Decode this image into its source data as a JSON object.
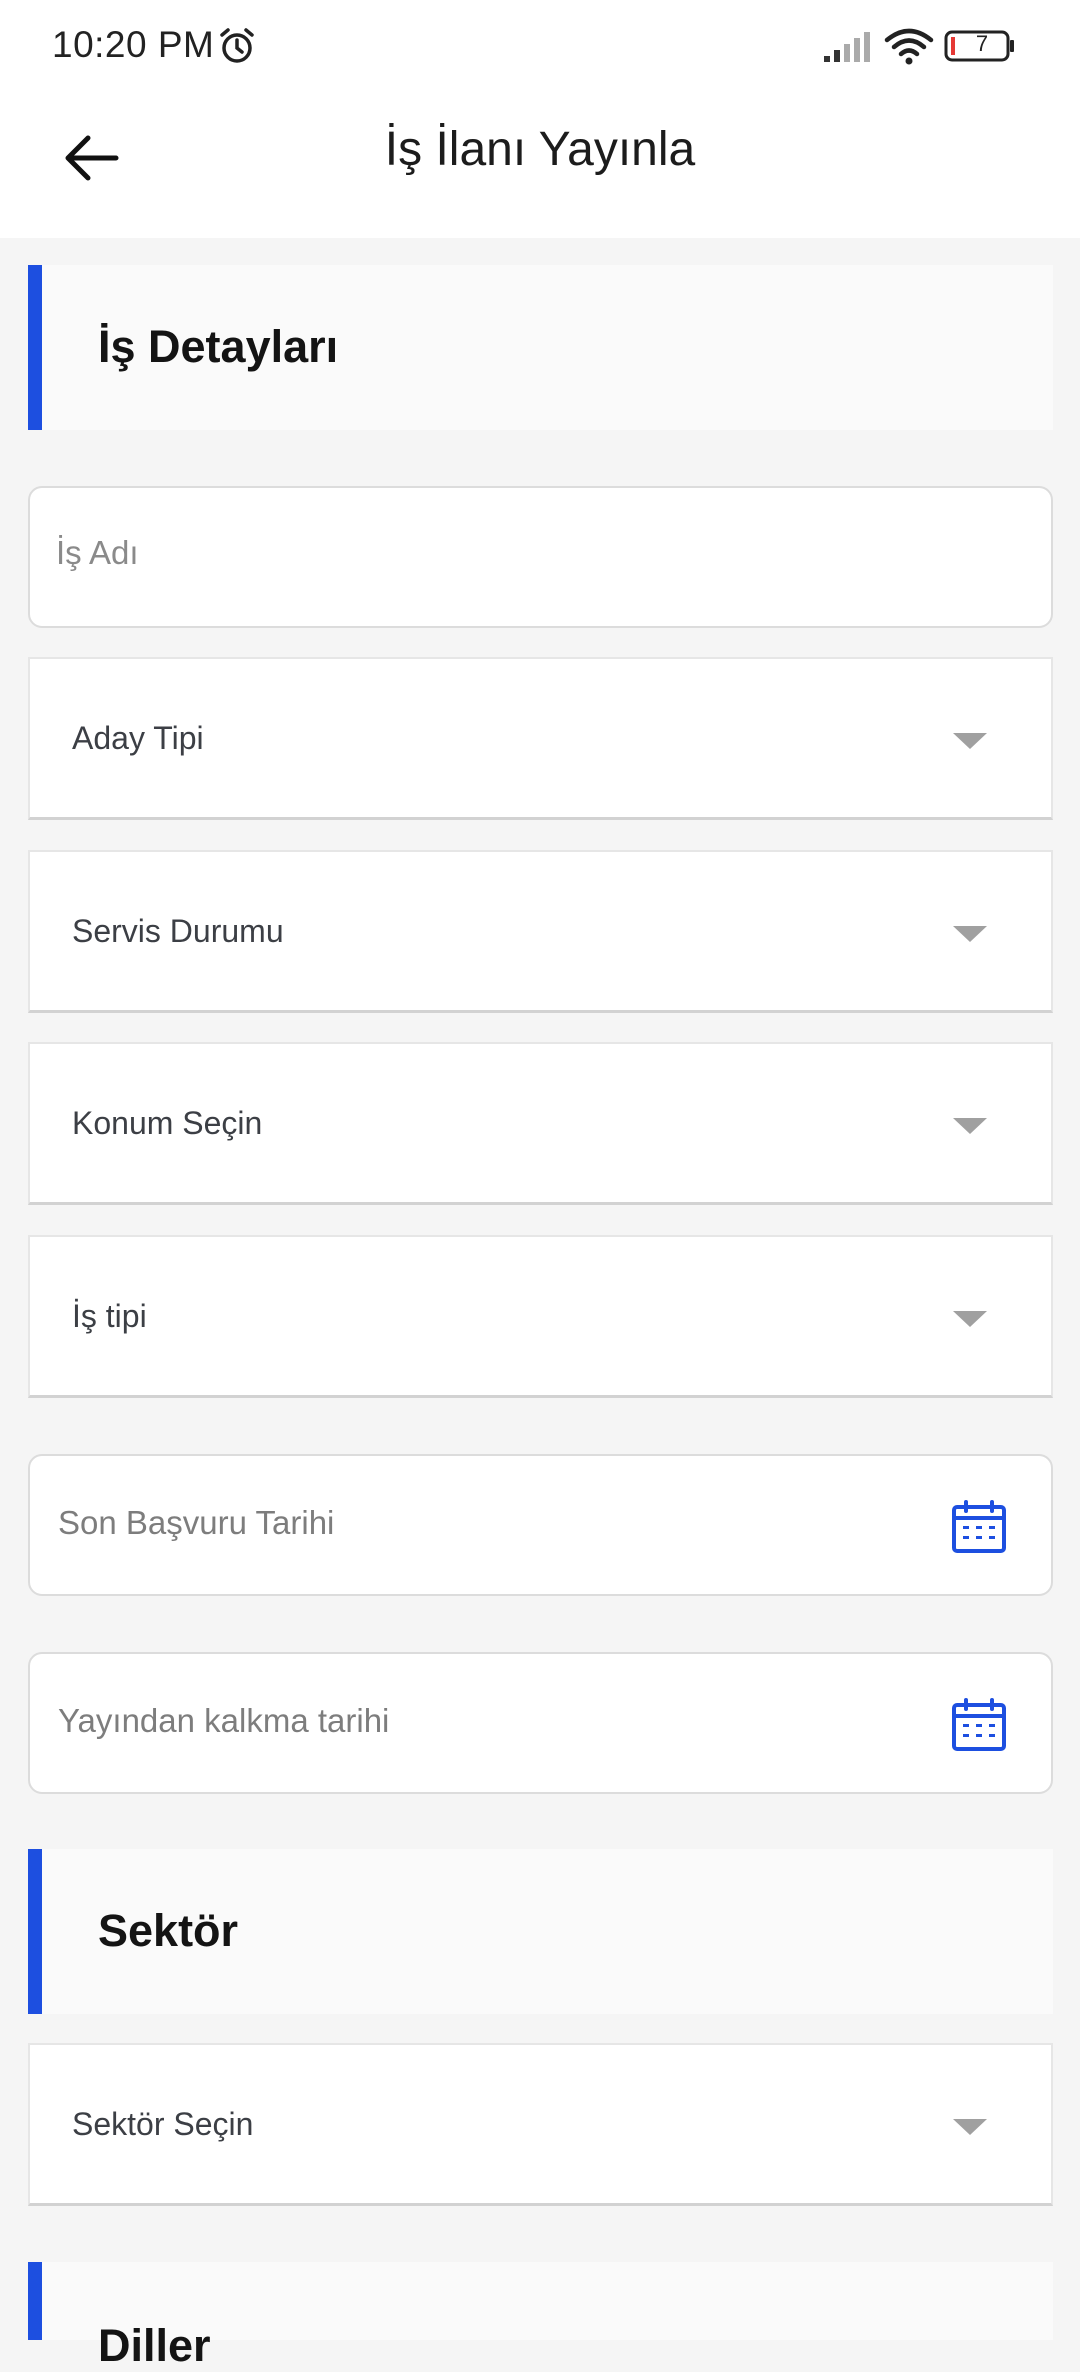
{
  "status_bar": {
    "time": "10:20 PM",
    "battery_level": "7",
    "icons": [
      "alarm-icon",
      "signal-icon",
      "wifi-icon",
      "battery-icon"
    ]
  },
  "app_bar": {
    "title": "İş İlanı Yayınla",
    "back_icon": "arrow-left-icon"
  },
  "sections": {
    "job_details": {
      "title": "İş Detayları"
    },
    "sector": {
      "title": "Sektör"
    },
    "languages": {
      "title": "Diller"
    }
  },
  "form": {
    "job_name": {
      "placeholder": "İş Adı",
      "value": ""
    },
    "candidate_type": {
      "label": "Aday Tipi"
    },
    "service_status": {
      "label": "Servis Durumu"
    },
    "location": {
      "label": "Konum Seçin"
    },
    "job_type": {
      "label": "İş tipi"
    },
    "application_deadline": {
      "placeholder": "Son Başvuru Tarihi",
      "icon": "calendar-icon"
    },
    "unpublish_date": {
      "placeholder": "Yayından kalkma tarihi",
      "icon": "calendar-icon"
    },
    "sector_select": {
      "label": "Sektör Seçin"
    }
  },
  "colors": {
    "accent": "#1d4fe0",
    "background": "#f5f5f5",
    "surface": "#ffffff"
  }
}
